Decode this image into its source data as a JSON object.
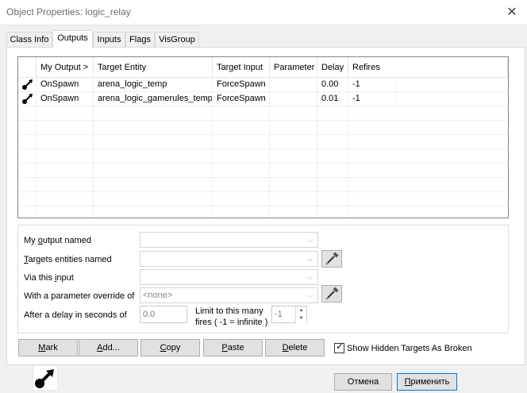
{
  "window": {
    "title": "Object Properties: logic_relay",
    "close_glyph": "✕"
  },
  "tabs": [
    {
      "label": "Class Info",
      "active": false
    },
    {
      "label": "Outputs",
      "active": true
    },
    {
      "label": "Inputs",
      "active": false
    },
    {
      "label": "Flags",
      "active": false
    },
    {
      "label": "VisGroup",
      "active": false
    }
  ],
  "grid": {
    "columns": [
      "My Output  >",
      "Target Entity",
      "Target Input",
      "Parameter",
      "Delay",
      "Refires"
    ],
    "rows": [
      {
        "icon": "output-connection-icon",
        "output": "OnSpawn",
        "target": "arena_logic_temp",
        "input": "ForceSpawn",
        "param": "",
        "delay": "0.00",
        "refires": "-1"
      },
      {
        "icon": "output-connection-icon",
        "output": "OnSpawn",
        "target": "arena_logic_gamerules_temp",
        "input": "ForceSpawn",
        "param": "",
        "delay": "0.01",
        "refires": "-1"
      }
    ]
  },
  "form": {
    "output_named_label": {
      "pre": "My ",
      "u": "o",
      "post": "utput named"
    },
    "targets_named_label": {
      "u": "T",
      "post": "argets entities named"
    },
    "via_input_label": {
      "pre": "Via this ",
      "u": "i",
      "post": "nput"
    },
    "param_override_label": "With a parameter override of",
    "param_override_value": "<none>",
    "delay_label": "After a delay in seconds of",
    "delay_value": "0.0",
    "limit_label_1": "Limit to this many",
    "limit_label_2": "fires  ( -1 = infinite )",
    "limit_value": "-1"
  },
  "buttons": {
    "mark": {
      "u": "M",
      "post": "ark"
    },
    "add": {
      "u": "A",
      "post": "dd..."
    },
    "copy": {
      "u": "C",
      "post": "opy"
    },
    "paste": {
      "u": "P",
      "post": "aste"
    },
    "delete": {
      "u": "D",
      "post": "elete"
    },
    "cancel": "Отмена",
    "apply": {
      "u": "П",
      "post": "рименить"
    }
  },
  "show_hidden": {
    "label": "Show Hidden Targets As Broken",
    "checked": true
  },
  "colors": {
    "panel_bg": "#f0f0f0",
    "content_bg": "#ffffff",
    "button_bg": "#e1e1e1",
    "button_border": "#adadad"
  }
}
